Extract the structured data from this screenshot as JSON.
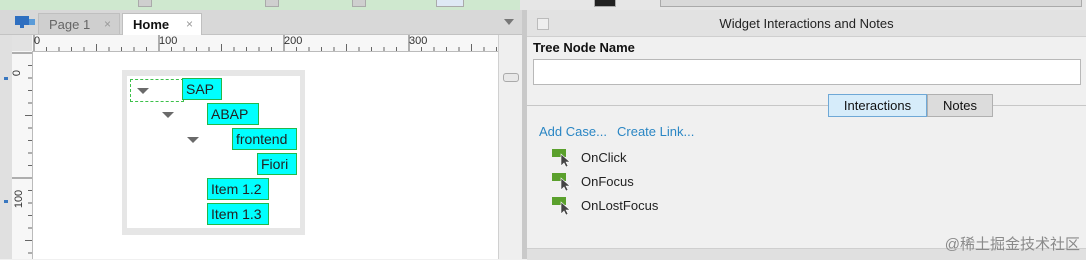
{
  "tabs": {
    "inactive_label": "Page 1",
    "active_label": "Home",
    "close_glyph": "×"
  },
  "ruler": {
    "h_labels": [
      "0",
      "100",
      "200",
      "300"
    ],
    "v_labels": [
      "0",
      "100"
    ]
  },
  "tree": {
    "nodes": [
      "SAP",
      "ABAP",
      "frontend",
      "Fiori",
      "Item 1.2",
      "Item 1.3"
    ]
  },
  "panel": {
    "title": "Widget Interactions and Notes",
    "tree_node_label": "Tree Node Name",
    "tree_node_value": "",
    "tab_interactions": "Interactions",
    "tab_notes": "Notes",
    "add_case": "Add Case...",
    "create_link": "Create Link...",
    "events": [
      "OnClick",
      "OnFocus",
      "OnLostFocus"
    ]
  },
  "watermark": "@稀土掘金技术社区",
  "colors": {
    "node_fill": "#00ffff",
    "node_border": "#22b84a",
    "link": "#2a86c4",
    "event_icon": "#5aa02c",
    "active_tab": "#d6ecfa"
  },
  "icons": [
    "sitemap-icon",
    "close-icon",
    "chevron-down-icon",
    "expand-triangle-icon",
    "interaction-event-icon"
  ]
}
